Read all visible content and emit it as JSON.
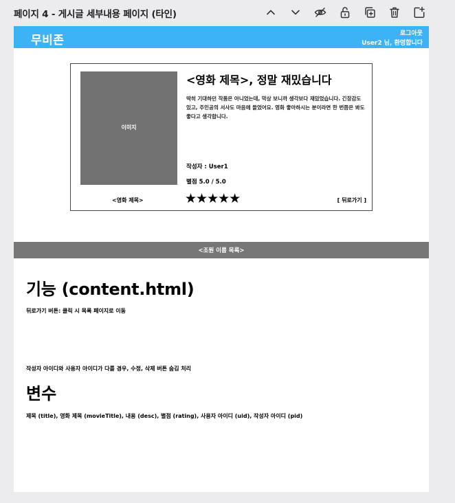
{
  "toolbar": {
    "title": "페이지 4 - 게시글 세부내용 페이지 (타인)",
    "icons": [
      "chevron-up-icon",
      "chevron-down-icon",
      "eye-off-icon",
      "unlock-icon",
      "duplicate-icon",
      "trash-icon",
      "add-page-icon"
    ]
  },
  "header": {
    "logo": "무비존",
    "logout": "로그아웃",
    "welcome": "User2 님, 환영합니다"
  },
  "post": {
    "image_label": "이미지",
    "title": "<영화 제목>, 정말 재밌습니다",
    "description": "딱히 기대하던 작품은 아니었는데, 막상 보니까 생각보다 재밌었습니다. 긴장감도 있고, 주인공의 서사도 마음에 들었어요. 영화 좋아하시는 분이라면 한 번쯤은 봐도 좋다고 생각합니다.",
    "author": "작성자 : User1",
    "rating": "별점 5.0 / 5.0",
    "rating_value": 5,
    "rating_max": 5,
    "stars": "★★★★★",
    "movie_title": "<영화 제목>",
    "back": "[ 뒤로가기 ]"
  },
  "team_bar": "<조원 이름 목록>",
  "notes": {
    "function_heading": "기능 (content.html)",
    "note1": "뒤로가기 버튼: 클릭 시 목록 페이지로 이동",
    "note2": "작성자 아이디와 사용자 아이디가 다를 경우, 수정, 삭제 버튼 숨김 처리",
    "variable_heading": "변수",
    "note3": "제목 (title), 영화 제목 (movieTitle), 내용 (desc), 별점 (rating), 사용자 아이디 (uid), 작성자 아이디 (pid)"
  },
  "colors": {
    "header": "#3db3f6",
    "team_bar": "#777777",
    "poster": "#727272"
  }
}
